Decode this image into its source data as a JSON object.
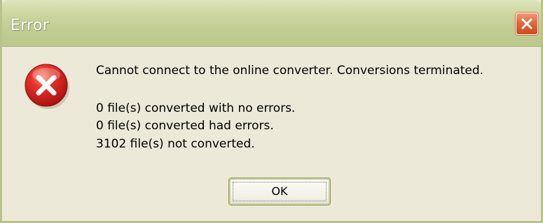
{
  "window": {
    "title": "Error"
  },
  "icons": {
    "close": "close-icon",
    "error": "error-icon"
  },
  "colors": {
    "titlebar": "#c2cd94",
    "dialog_bg": "#ece9d8",
    "close_button": "#e06a3c",
    "error_icon": "#d21a1a"
  },
  "message": {
    "line1": "Cannot connect to the online converter. Conversions terminated.",
    "line2": "0 file(s) converted with no errors.",
    "line3": "0 file(s) converted had errors.",
    "line4": "3102 file(s) not converted."
  },
  "buttons": {
    "ok": "OK"
  }
}
